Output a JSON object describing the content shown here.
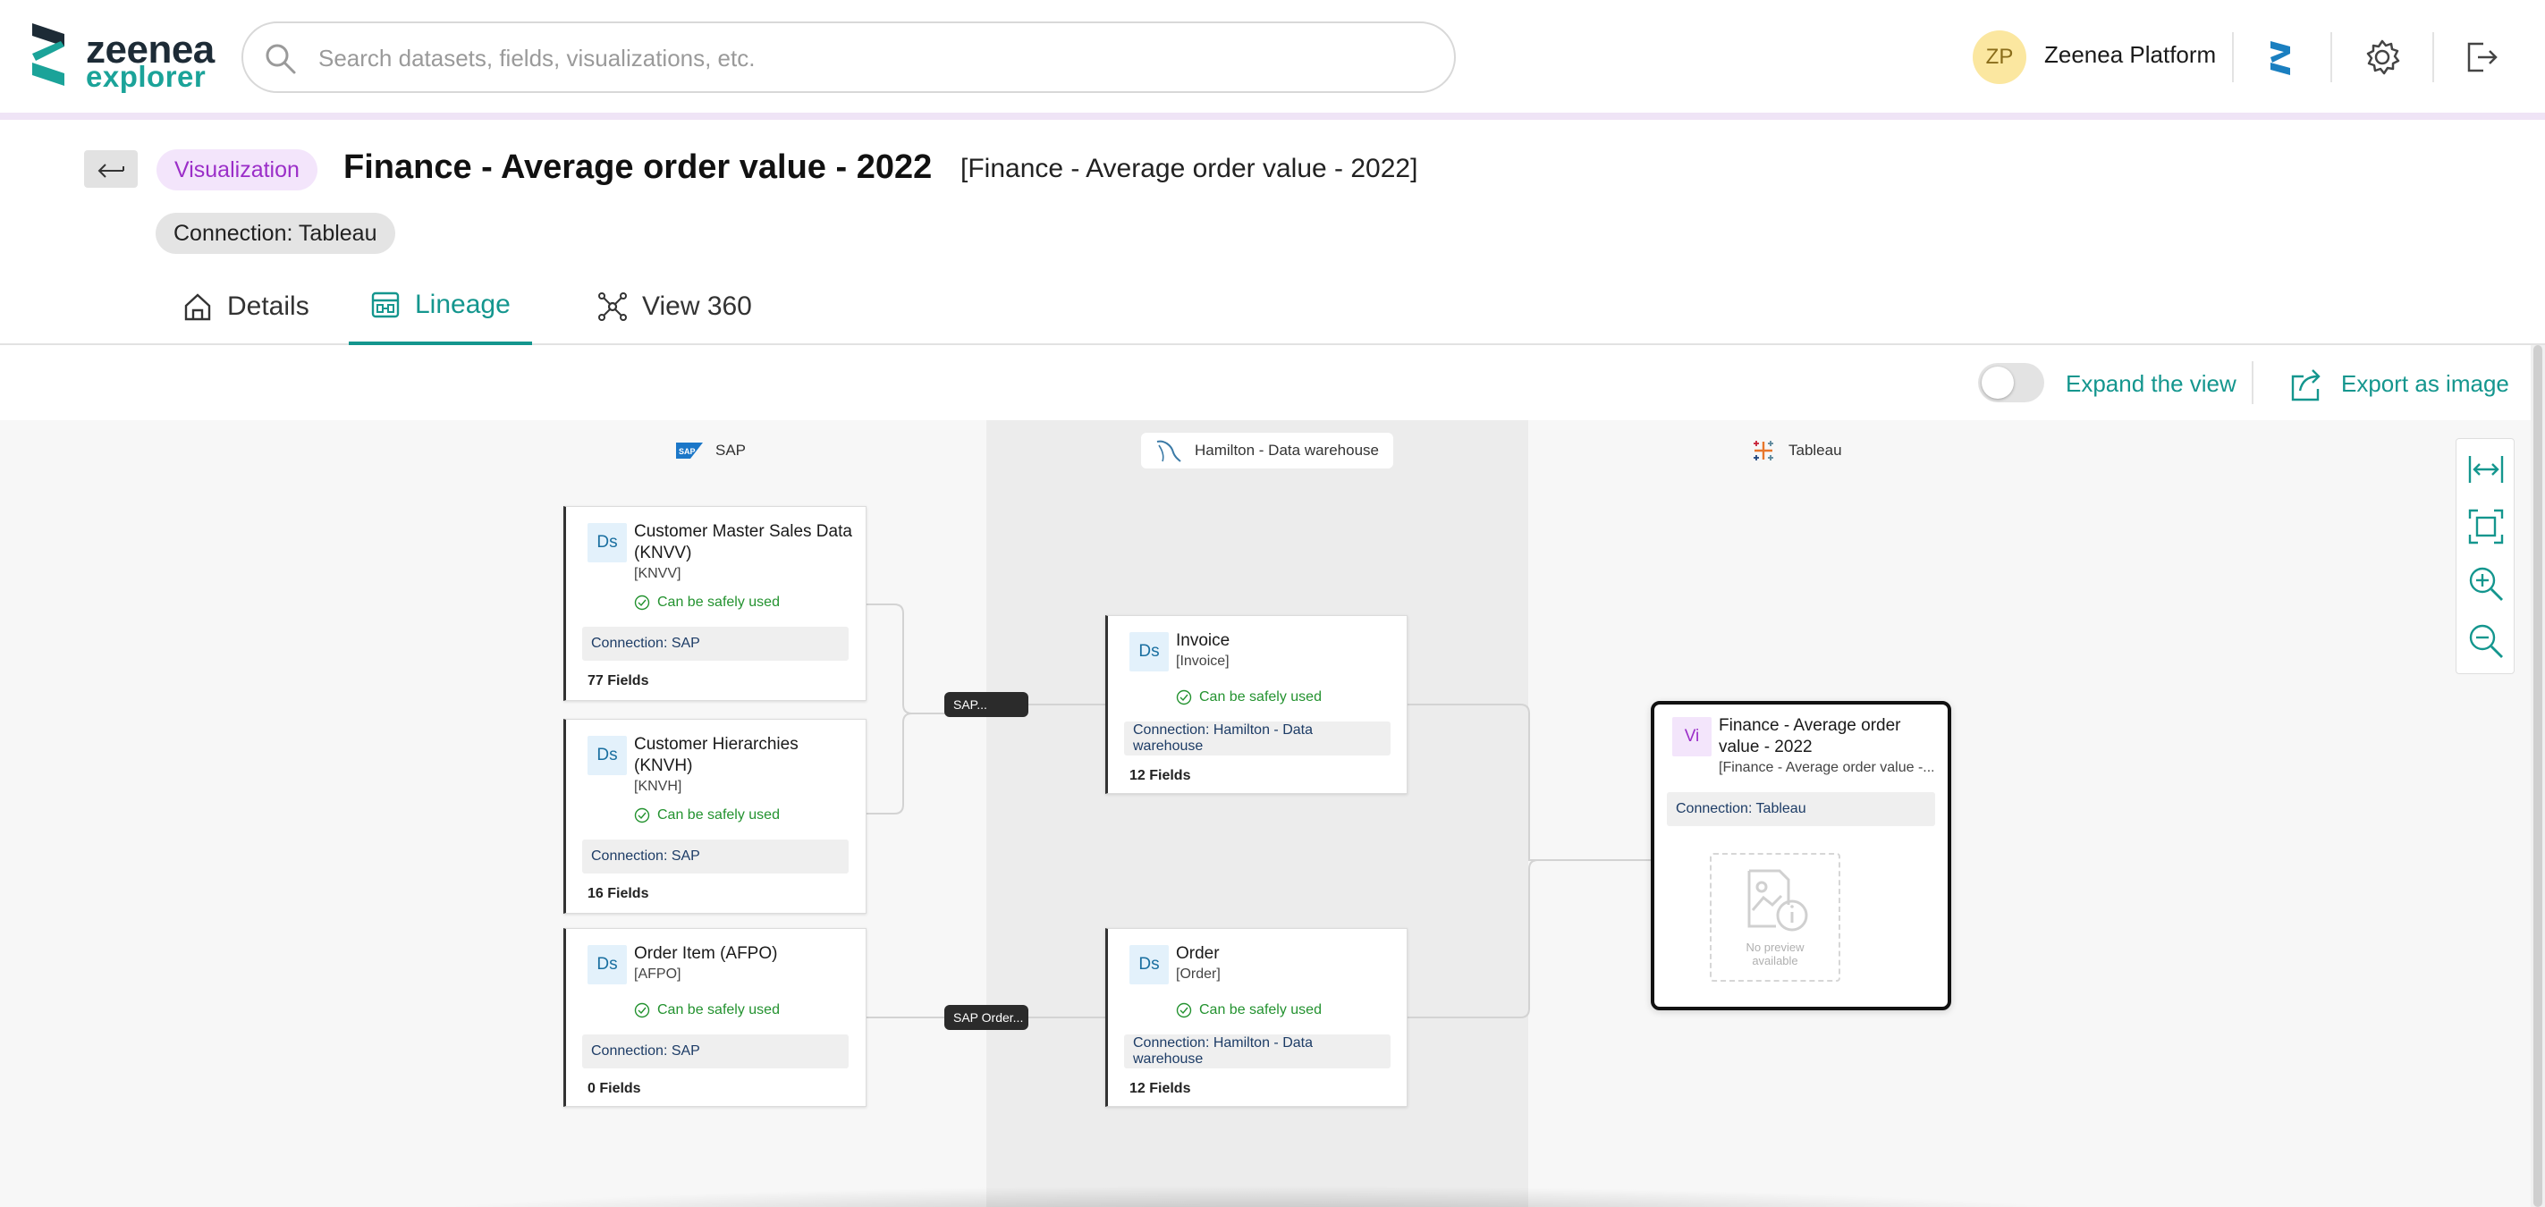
{
  "brand": {
    "word": "zeenea",
    "sub": "explorer",
    "accent": "#14968e"
  },
  "search": {
    "placeholder": "Search datasets, fields, visualizations, etc."
  },
  "user": {
    "initials": "ZP",
    "platform": "Zeenea Platform"
  },
  "header_icons": [
    "zeenea-studio-icon",
    "gear-icon",
    "logout-icon"
  ],
  "item": {
    "type": "Visualization",
    "title": "Finance - Average order value - 2022",
    "subtitle": "[Finance - Average order value - 2022]",
    "connection_chip": "Connection: Tableau"
  },
  "tabs": [
    {
      "label": "Details",
      "icon": "home-icon",
      "active": false
    },
    {
      "label": "Lineage",
      "icon": "lineage-icon",
      "active": true
    },
    {
      "label": "View 360",
      "icon": "graph-icon",
      "active": false
    }
  ],
  "toolbar": {
    "expand_label": "Expand the view",
    "expand_on": false,
    "export_label": "Export as image"
  },
  "columns": [
    {
      "label": "SAP",
      "icon": "sap-logo-icon"
    },
    {
      "label": "Hamilton - Data warehouse",
      "icon": "mysql-logo-icon"
    },
    {
      "label": "Tableau",
      "icon": "tableau-logo-icon"
    }
  ],
  "nodes": {
    "knvv": {
      "badge": "Ds",
      "name": "Customer Master Sales Data (KNVV)",
      "key": "[KNVV]",
      "status": "Can be safely used",
      "connection": "Connection: SAP",
      "fields": "77 Fields"
    },
    "knvh": {
      "badge": "Ds",
      "name": "Customer Hierarchies (KNVH)",
      "key": "[KNVH]",
      "status": "Can be safely used",
      "connection": "Connection: SAP",
      "fields": "16 Fields"
    },
    "afpo": {
      "badge": "Ds",
      "name": "Order Item (AFPO)",
      "key": "[AFPO]",
      "status": "Can be safely used",
      "connection": "Connection: SAP",
      "fields": "0 Fields"
    },
    "invoice": {
      "badge": "Ds",
      "name": "Invoice",
      "key": "[Invoice]",
      "status": "Can be safely used",
      "connection": "Connection: Hamilton - Data warehouse",
      "fields": "12 Fields"
    },
    "order": {
      "badge": "Ds",
      "name": "Order",
      "key": "[Order]",
      "status": "Can be safely used",
      "connection": "Connection: Hamilton - Data warehouse",
      "fields": "12 Fields"
    },
    "viz": {
      "badge": "Vi",
      "name": "Finance - Average order value - 2022",
      "key": "[Finance - Average order value -...",
      "connection": "Connection: Tableau",
      "preview": "No preview available"
    }
  },
  "processes": [
    {
      "label": "SAP..."
    },
    {
      "label": "SAP Order..."
    }
  ],
  "zoom_controls": [
    "fit-width-icon",
    "fit-screen-icon",
    "zoom-in-icon",
    "zoom-out-icon"
  ]
}
